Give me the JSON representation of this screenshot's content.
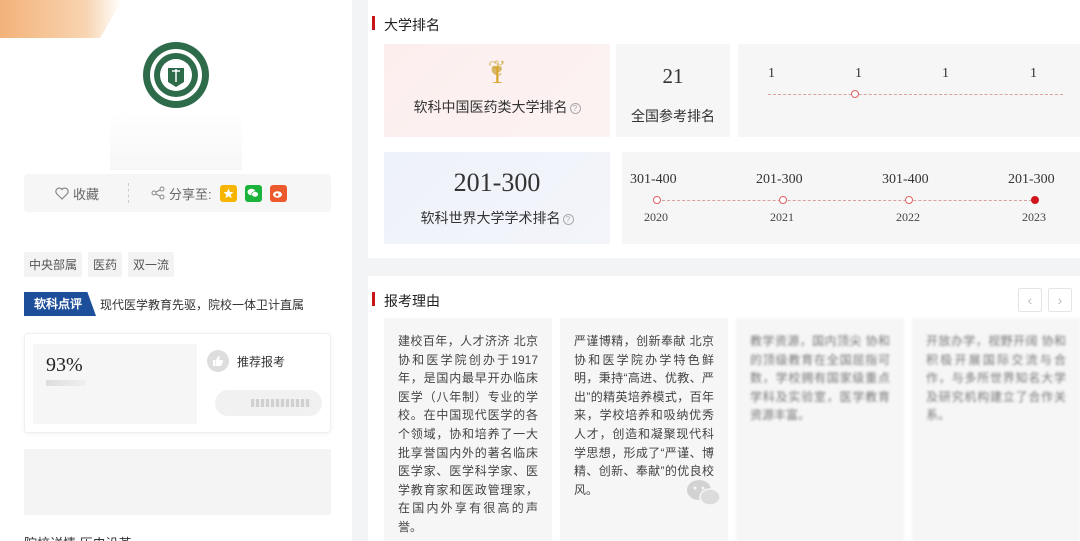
{
  "school": {
    "favorite_label": "收藏",
    "share_label": "分享至:",
    "share_icons": [
      "qzone-icon",
      "wechat-icon",
      "weibo-icon"
    ],
    "tags": [
      "中央部属",
      "医药",
      "双一流"
    ],
    "review_badge": "软科点评",
    "review_text": "现代医学教育先驱，院校一体卫计直属",
    "recommend_pct": "93%",
    "recommend_label": "推荐报考",
    "next_section_peek": "院校详情  历史沿革"
  },
  "ranking": {
    "title": "大学排名",
    "china_med": {
      "value": "1",
      "label": "软科中国医药类大学排名"
    },
    "national": {
      "value": "21",
      "label": "全国参考排名"
    },
    "china_history": [
      "1",
      "1",
      "1",
      "1"
    ],
    "world": {
      "value": "201-300",
      "label": "软科世界大学学术排名"
    },
    "world_history": [
      {
        "value": "301-400",
        "year": "2020"
      },
      {
        "value": "201-300",
        "year": "2021"
      },
      {
        "value": "301-400",
        "year": "2022"
      },
      {
        "value": "201-300",
        "year": "2023"
      }
    ],
    "colors": {
      "accent": "#c8161d",
      "gold": "#d7a52c",
      "badge_blue": "#1d4e9a"
    }
  },
  "reasons": {
    "title": "报考理由",
    "prev_label": "‹",
    "next_label": "›",
    "cards": [
      "建校百年，人才济济 北京协和医学院创办于1917年，是国内最早开办临床医学（八年制）专业的学校。在中国现代医学的各个领域，协和培养了一大批享誉国内外的著名临床医学家、医学科学家、医学教育家和医政管理家，在国内外享有很高的声誉。",
      "严谨博精，创新奉献 北京协和医学院办学特色鲜明，秉持“高进、优教、严出”的精英培养模式，百年来，学校培养和吸纳优秀人才，创造和凝聚现代科学思想，形成了“严谨、博精、创新、奉献”的优良校风。",
      "教学资源，国内顶尖 协和的顶级教育在全国屈指可数，学校拥有国家级重点学科及实验室，医学教育资源丰富。",
      "开放办学，视野开阔 协和积极开展国际交流与合作，与多所世界知名大学及研究机构建立了合作关系。"
    ]
  }
}
